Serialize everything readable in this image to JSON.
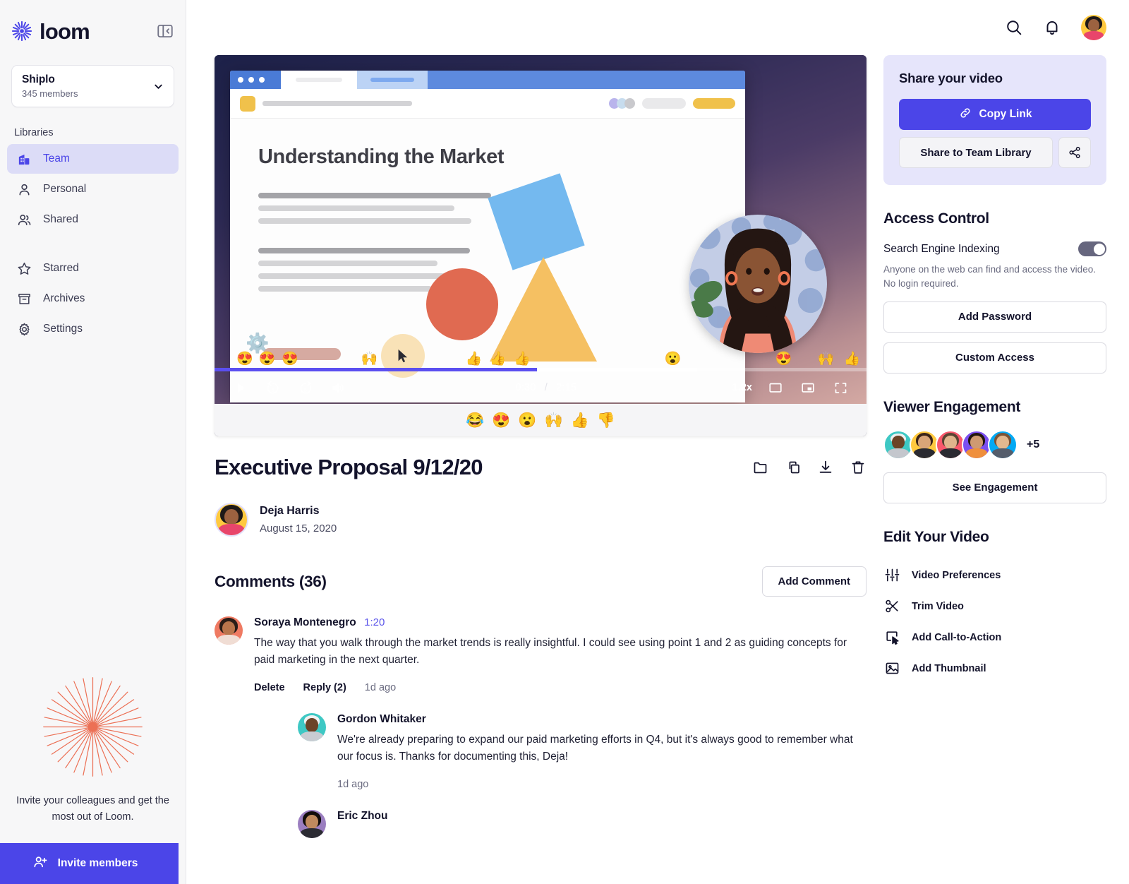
{
  "brand": {
    "name": "loom",
    "accent": "#4b45e8",
    "active_bg": "#dcdcf7"
  },
  "sidebar": {
    "workspace": {
      "name": "Shiplo",
      "members": "345 members"
    },
    "section_label": "Libraries",
    "items": [
      {
        "label": "Team",
        "icon": "building-icon",
        "active": true
      },
      {
        "label": "Personal",
        "icon": "person-icon",
        "active": false
      },
      {
        "label": "Shared",
        "icon": "people-icon",
        "active": false
      }
    ],
    "items2": [
      {
        "label": "Starred",
        "icon": "star-icon"
      },
      {
        "label": "Archives",
        "icon": "archive-icon"
      },
      {
        "label": "Settings",
        "icon": "gear-icon"
      }
    ],
    "invite": {
      "copy": "Invite your colleagues and get the most out of Loom.",
      "button": "Invite members"
    }
  },
  "topbar": {
    "search": "search-icon",
    "notifications": "bell-icon",
    "avatar": "user-avatar"
  },
  "player": {
    "slide_title": "Understanding the Market",
    "current_time": "0:30",
    "separator": "/",
    "duration": "2:15",
    "speed": "1.2x",
    "progress_percent": 49.5,
    "buffered_percent": 74,
    "controls": [
      "play-icon",
      "rewind-5-icon",
      "forward-5-icon",
      "volume-icon"
    ],
    "right_controls": [
      "theater-mode-icon",
      "picture-in-picture-icon",
      "fullscreen-icon"
    ],
    "reaction_bar": [
      "😂",
      "😍",
      "😮",
      "🙌",
      "👍",
      "👎"
    ],
    "timeline_reactions": [
      {
        "emoji": "😍",
        "left_percent": 3.4
      },
      {
        "emoji": "😍",
        "left_percent": 6.8
      },
      {
        "emoji": "😍",
        "left_percent": 10.3
      },
      {
        "emoji": "🙌",
        "left_percent": 22.5
      },
      {
        "emoji": "👍",
        "left_percent": 38.5
      },
      {
        "emoji": "👍",
        "left_percent": 42.2
      },
      {
        "emoji": "👍",
        "left_percent": 45.9
      },
      {
        "emoji": "😮",
        "left_percent": 69.0
      },
      {
        "emoji": "😍",
        "left_percent": 86.0
      },
      {
        "emoji": "🙌",
        "left_percent": 92.5
      },
      {
        "emoji": "👍",
        "left_percent": 96.5
      }
    ]
  },
  "video": {
    "title": "Executive Proposal 9/12/20",
    "actions": [
      "move-to-folder-icon",
      "duplicate-icon",
      "download-icon",
      "delete-icon"
    ],
    "author": {
      "name": "Deja Harris",
      "date": "August 15, 2020"
    }
  },
  "comments": {
    "heading": "Comments (36)",
    "add_button": "Add Comment",
    "list": [
      {
        "author": "Soraya Montenegro",
        "timestamp": "1:20",
        "text": "The way that you walk through the market trends is really insightful. I could see using point 1 and 2 as guiding concepts for paid marketing in the next quarter.",
        "delete_label": "Delete",
        "reply_label": "Reply (2)",
        "ago": "1d ago",
        "replies": [
          {
            "author": "Gordon Whitaker",
            "text": "We're already preparing to expand our paid marketing efforts in Q4, but it's always good to remember what our focus is. Thanks for documenting this, Deja!",
            "ago": "1d ago"
          },
          {
            "author": "Eric Zhou",
            "text": "",
            "ago": ""
          }
        ]
      }
    ]
  },
  "share": {
    "title": "Share your video",
    "copy_link": "Copy Link",
    "team_library": "Share to Team Library",
    "share_icon": "share-nodes-icon"
  },
  "access": {
    "title": "Access Control",
    "toggle_label": "Search Engine Indexing",
    "toggle_on": true,
    "help": "Anyone on the web can find and access the video. No login required.",
    "add_password": "Add Password",
    "custom_access": "Custom Access"
  },
  "engagement": {
    "title": "Viewer Engagement",
    "overflow": "+5",
    "button": "See Engagement",
    "avatar_colors": [
      "#3ec8c4",
      "#ffc93f",
      "#f9586c",
      "#7b4ff0",
      "#03a9f4"
    ]
  },
  "edit": {
    "title": "Edit Your Video",
    "items": [
      {
        "label": "Video Preferences",
        "icon": "sliders-icon"
      },
      {
        "label": "Trim Video",
        "icon": "scissors-icon"
      },
      {
        "label": "Add Call-to-Action",
        "icon": "cta-cursor-icon"
      },
      {
        "label": "Add Thumbnail",
        "icon": "image-icon"
      }
    ]
  }
}
